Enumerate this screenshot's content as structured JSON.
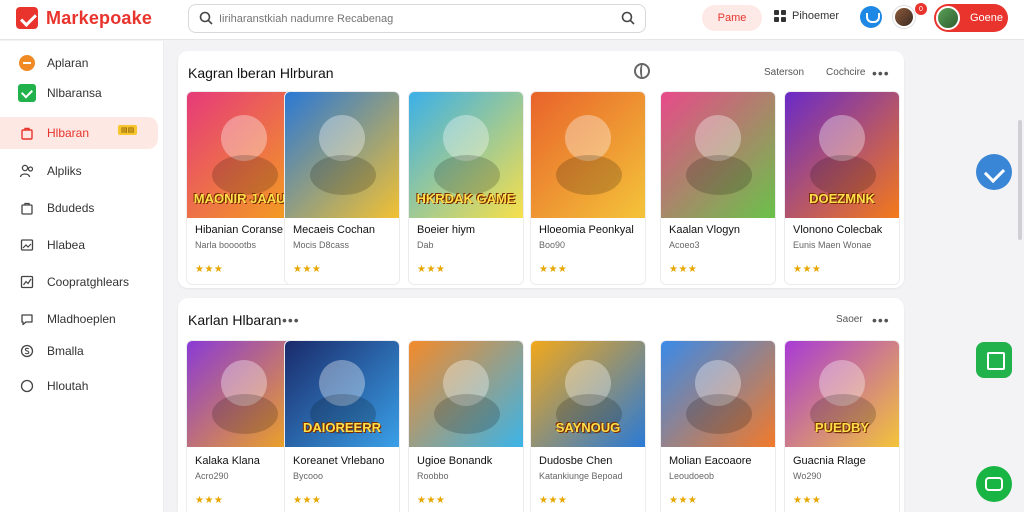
{
  "app": {
    "brand": "Markepoake",
    "search_placeholder": "Iiriharanstkiah nadumre Recabenag",
    "pill_button": "Pame",
    "menu_link": "Pihoemer",
    "avatar_badge": "0",
    "account_label": "Goene"
  },
  "sidebar": {
    "items": [
      {
        "label": "Aplaran",
        "icon": "orange-circle-icon"
      },
      {
        "label": "Nlbaransa",
        "icon": "green-check-icon"
      },
      {
        "label": "Hlbaran",
        "icon": "bag-icon",
        "badge": "▤▤"
      },
      {
        "label": "Alpliks",
        "icon": "users-icon"
      },
      {
        "label": "Bdudeds",
        "icon": "bag-outline-icon"
      },
      {
        "label": "Hlabea",
        "icon": "image-icon"
      },
      {
        "label": "Coopratghlears",
        "icon": "chart-icon"
      },
      {
        "label": "Mladhoeplen",
        "icon": "chat-icon"
      },
      {
        "label": "Bmalla",
        "icon": "dollar-icon"
      },
      {
        "label": "Hloutah",
        "icon": "circle-icon"
      }
    ]
  },
  "section1": {
    "title": "Kagran lberan Hlrburan",
    "tabs": [
      "Saterson",
      "Cochcire"
    ],
    "cards": [
      {
        "name": "Hibanian Coranse",
        "sub": "Narla booootbs",
        "thumb_title": "MAONIR JAAUS",
        "c1": "#e63a7a",
        "c2": "#f4a21b",
        "stars": "★★★"
      },
      {
        "name": "Mecaeis Cochan",
        "sub": "Mocis D8cass",
        "thumb_title": "",
        "c1": "#2a78d6",
        "c2": "#f2c132",
        "stars": "★★★"
      },
      {
        "name": "Boeier hiym",
        "sub": "Dab",
        "thumb_title": "HKRDAK GAME",
        "c1": "#3ab0e8",
        "c2": "#f8e04a",
        "stars": "★★★"
      },
      {
        "name": "Hloeomia Peonkyal",
        "sub": "Boo90",
        "thumb_title": "",
        "c1": "#e8632a",
        "c2": "#f4c43a",
        "stars": "★★★"
      },
      {
        "name": "Kaalan Vlogyn",
        "sub": "Acoeo3",
        "thumb_title": "",
        "c1": "#e84a8a",
        "c2": "#6ac24a",
        "stars": "★★★"
      },
      {
        "name": "Vlonono Colecbak",
        "sub": "Eunis Maen Wonae",
        "thumb_title": "DOEZMNK",
        "c1": "#6a2ac8",
        "c2": "#f47a1a",
        "stars": "★★★"
      }
    ]
  },
  "section2": {
    "title": "Karlan Hlbaran",
    "action": "Saoer",
    "cards": [
      {
        "name": "Kalaka Klana",
        "sub": "Acro290",
        "thumb_title": "",
        "c1": "#8a3ad6",
        "c2": "#f2a81b",
        "stars": "★★★"
      },
      {
        "name": "Koreanet Vrlebano",
        "sub": "Bycooo",
        "thumb_title": "DAIOREERR",
        "c1": "#1a2a6a",
        "c2": "#3aa0e8",
        "stars": "★★★"
      },
      {
        "name": "Ugioe Bonandk",
        "sub": "Roobbo",
        "thumb_title": "",
        "c1": "#f48a2a",
        "c2": "#3ab4e8",
        "stars": "★★★"
      },
      {
        "name": "Dudosbe Chen",
        "sub": "Katankiunge Bepoad",
        "thumb_title": "SAYNOUG",
        "c1": "#f2a81b",
        "c2": "#2a7ad6",
        "stars": "★★★"
      },
      {
        "name": "Molian Eacoaore",
        "sub": "Leoudoeob",
        "thumb_title": "",
        "c1": "#3a8ae8",
        "c2": "#f27a2a",
        "stars": "★★★"
      },
      {
        "name": "Guacnia Rlage",
        "sub": "Wo290",
        "thumb_title": "PUEDBY",
        "c1": "#a83ad6",
        "c2": "#f4c43a",
        "stars": "★★★"
      }
    ]
  }
}
